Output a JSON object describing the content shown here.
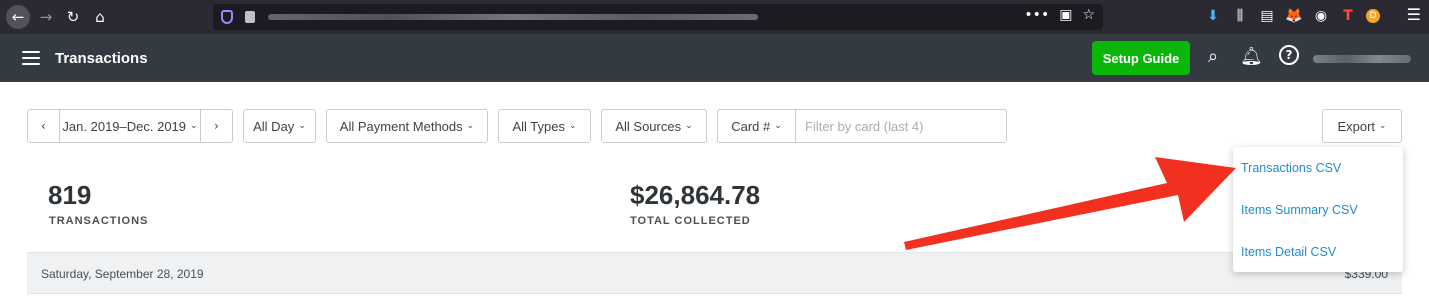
{
  "browser": {
    "nav": {
      "back": "←",
      "forward": "→",
      "reload": "↻",
      "home": "⌂"
    },
    "url_actions": [
      "•••",
      "▣",
      "☆"
    ],
    "toolbar_icons": [
      "⬇",
      "⫼",
      "▤",
      "🦊",
      "◉",
      "T",
      "D"
    ],
    "menu": "☰"
  },
  "header": {
    "title": "Transactions",
    "setup_button": "Setup Guide",
    "icons": {
      "search": "⌕",
      "bell": "🔔︎",
      "help": "?"
    }
  },
  "filters": {
    "prev": "‹",
    "date_range": "Jan. 2019–Dec. 2019",
    "next": "›",
    "time": "All Day",
    "payment_methods": "All Payment Methods",
    "types": "All Types",
    "sources": "All Sources",
    "card_select": "Card #",
    "card_placeholder": "Filter by card (last 4)",
    "export": "Export",
    "chevron": "⌄"
  },
  "stats": [
    {
      "value": "819",
      "label": "TRANSACTIONS"
    },
    {
      "value": "$26,864.78",
      "label": "TOTAL COLLECTED"
    }
  ],
  "date_row": {
    "label": "Saturday, September 28, 2019",
    "amount": "$339.00"
  },
  "export_menu": {
    "items": [
      "Transactions CSV",
      "Items Summary CSV",
      "Items Detail CSV"
    ]
  },
  "colors": {
    "header_bg": "#333a41",
    "setup_green": "#0bb60b",
    "link_blue": "#1f8dcc",
    "arrow_red": "#f2301f"
  }
}
